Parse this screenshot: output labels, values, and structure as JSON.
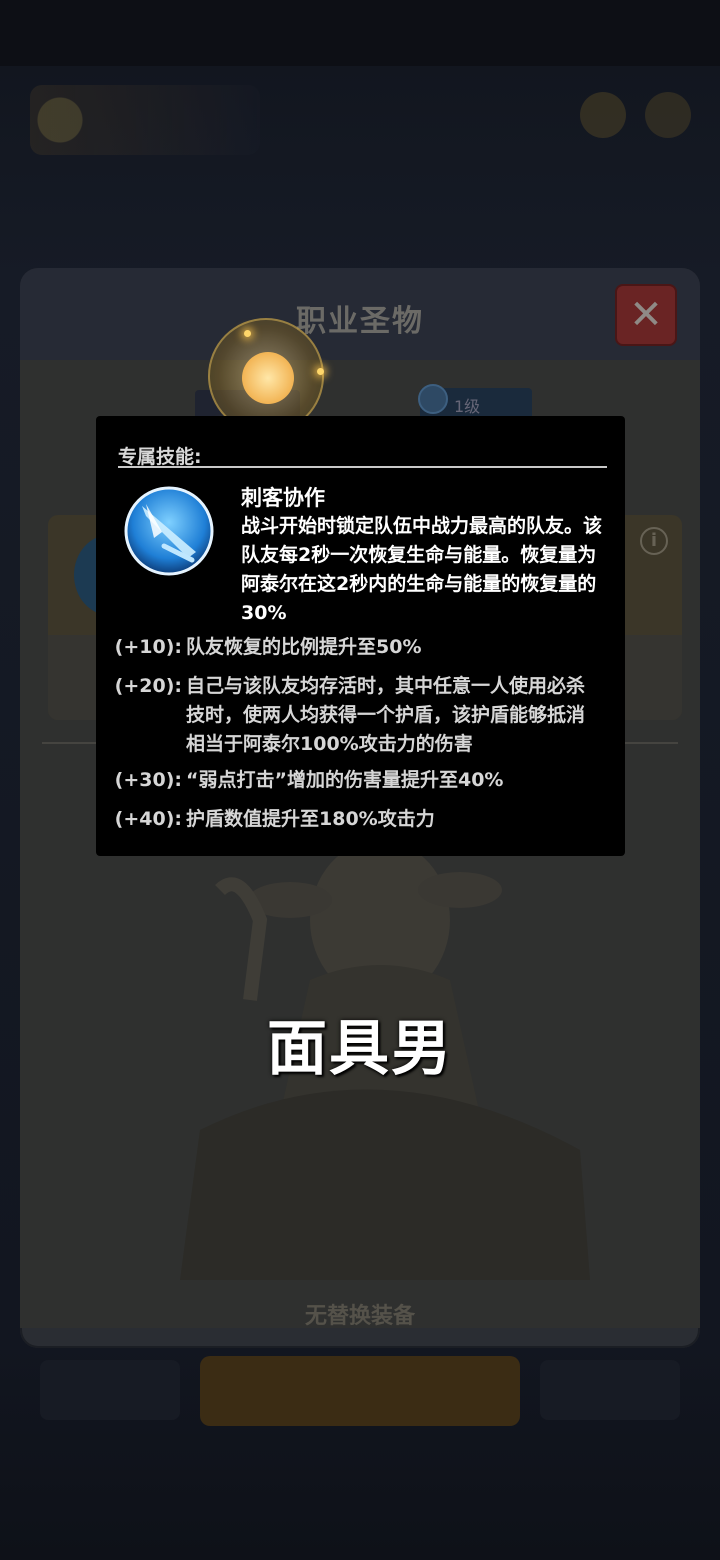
{
  "panel": {
    "title": "职业圣物",
    "close_icon": "close-x-icon",
    "level_tag": "1级",
    "no_replace_text": "无替换装备"
  },
  "tooltip": {
    "header": "专属技能:",
    "skill_icon": "blue-blade-skill-icon",
    "skill_name": "刺客协作",
    "skill_desc": "战斗开始时锁定队伍中战力最高的队友。该队友每2秒一次恢复生命与能量。恢复量为阿泰尔在这2秒内的生命与能量的恢复量的30%",
    "bonuses": [
      {
        "level": "(+10):",
        "text": "队友恢复的比例提升至50%"
      },
      {
        "level": "(+20):",
        "text": "自己与该队友均存活时，其中任意一人使用必杀技时，使两人均获得一个护盾，该护盾能够抵消相当于阿泰尔100%攻击力的伤害"
      },
      {
        "level": "(+30):",
        "text": "“弱点打击”增加的伤害量提升至40%"
      },
      {
        "level": "(+40):",
        "text": "护盾数值提升至180%攻击力"
      }
    ]
  },
  "caption": "面具男",
  "colors": {
    "tooltip_bg": "#000000",
    "close_button": "#6a2424",
    "orb_glow": "#f2b454",
    "skill_icon_blue": "#3aa0ea"
  }
}
